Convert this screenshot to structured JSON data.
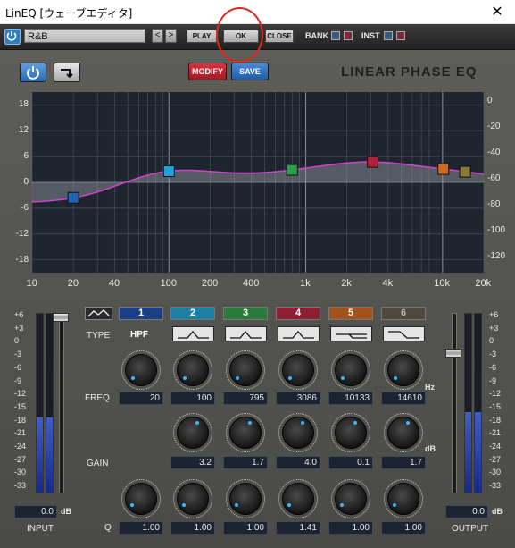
{
  "window": {
    "title": "LinEQ [ウェーブエディタ]",
    "close_glyph": "✕"
  },
  "toolbar": {
    "preset_name": "R&B",
    "prev_glyph": "<",
    "next_glyph": ">",
    "play_label": "PLAY",
    "ok_label": "OK",
    "close_label": "CLOSE",
    "bank_label": "BANK",
    "inst_label": "INST"
  },
  "controls": {
    "power_icon": "power-icon",
    "power_glyph": "⏻",
    "bypass_icon": "routing-arrow-icon",
    "bypass_glyph": "↴",
    "modify_label": "MODIFY",
    "save_label": "SAVE",
    "plugin_title": "LINEAR PHASE EQ"
  },
  "graph": {
    "gain_axis": [
      "18",
      "12",
      "6",
      "0",
      "-6",
      "-12",
      "-18"
    ],
    "level_axis": [
      "0",
      "-20",
      "-40",
      "-60",
      "-80",
      "-100",
      "-120"
    ],
    "freq_axis": [
      "10",
      "20",
      "40",
      "100",
      "200",
      "400",
      "1k",
      "2k",
      "4k",
      "10k",
      "20k"
    ],
    "curve_color": "#cc44cc",
    "bands": [
      {
        "id": 1,
        "color": "#1f62b8",
        "freq": 20,
        "gain": -4.8
      },
      {
        "id": 2,
        "color": "#1ea2d8",
        "freq": 100,
        "gain": 3.2
      },
      {
        "id": 3,
        "color": "#27a04a",
        "freq": 795,
        "gain": 1.7
      },
      {
        "id": 4,
        "color": "#b0203a",
        "freq": 3086,
        "gain": 4.0
      },
      {
        "id": 5,
        "color": "#d06a1c",
        "freq": 10133,
        "gain": 0.1
      },
      {
        "id": 6,
        "color": "#8a7a3a",
        "freq": 14610,
        "gain": 1.7
      }
    ]
  },
  "input": {
    "label": "INPUT",
    "value": "0.0",
    "unit": "dB",
    "fader_level": 1.0,
    "meter_level": 0.42
  },
  "output": {
    "label": "OUTPUT",
    "value": "0.0",
    "unit": "dB",
    "fader_level": 0.79,
    "meter_level": 0.45
  },
  "scale": [
    "+6",
    "+3",
    "0",
    "-3",
    "-6",
    "-9",
    "-12",
    "-15",
    "-18",
    "-21",
    "-24",
    "-27",
    "-30",
    "-33"
  ],
  "rows": {
    "type": "TYPE",
    "freq": "FREQ",
    "gain": "GAIN",
    "q": "Q"
  },
  "units": {
    "hz": "Hz",
    "db": "dB"
  },
  "band_buttons": [
    {
      "number": "1",
      "bg": "#1a3f86",
      "fg": "#ffffff",
      "type_text": "HPF"
    },
    {
      "number": "2",
      "bg": "#1e7fa6",
      "fg": "#ffffff",
      "type_icon": "bell-filter-icon"
    },
    {
      "number": "3",
      "bg": "#2a7a3c",
      "fg": "#ffffff",
      "type_icon": "bell-filter-icon"
    },
    {
      "number": "4",
      "bg": "#8e1f33",
      "fg": "#ffffff",
      "type_icon": "bell-filter-icon"
    },
    {
      "number": "5",
      "bg": "#a2521a",
      "fg": "#ffffff",
      "type_icon": "notch-shelf-icon"
    },
    {
      "number": "6",
      "bg": "#4c4a3c",
      "fg": "#b8b8b0",
      "type_icon": "high-shelf-icon"
    }
  ],
  "freq_values": [
    "20",
    "100",
    "795",
    "3086",
    "10133",
    "14610"
  ],
  "gain_values": [
    "3.2",
    "1.7",
    "4.0",
    "0.1",
    "1.7"
  ],
  "q_values": [
    "1.00",
    "1.00",
    "1.00",
    "1.41",
    "1.00",
    "1.00"
  ],
  "display_mode_icon": "response-curve-icon"
}
